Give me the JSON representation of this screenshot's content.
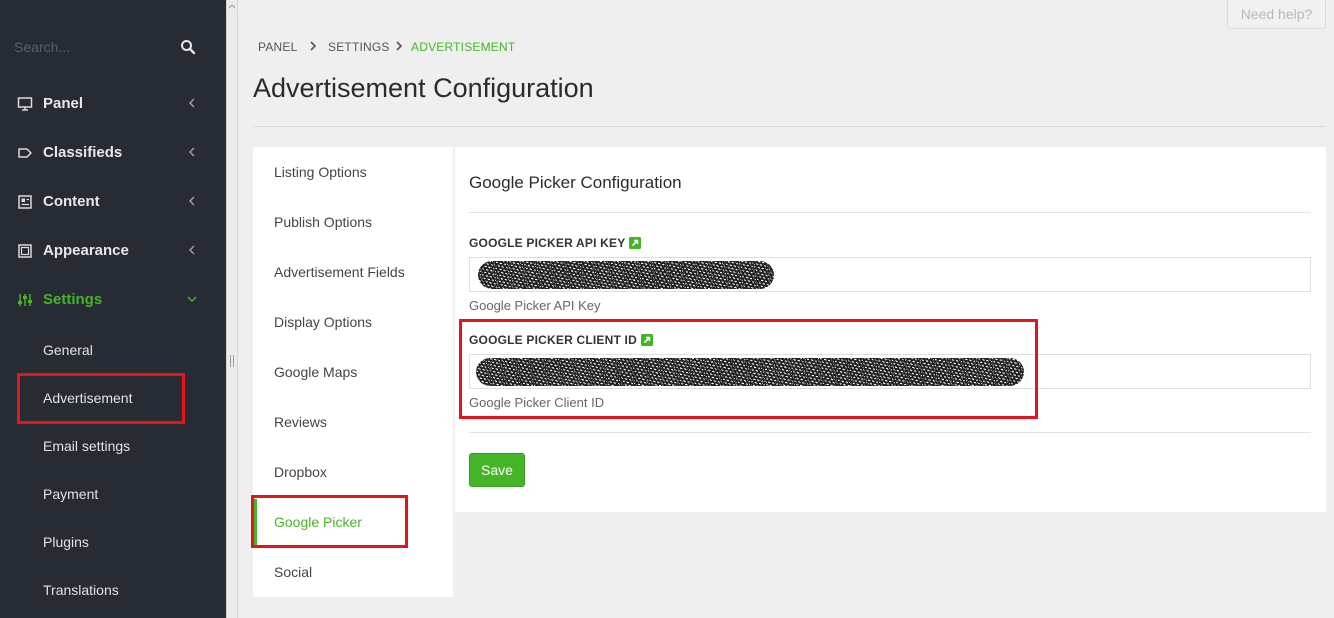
{
  "sidebar": {
    "search_placeholder": "Search...",
    "menu": [
      {
        "label": "Panel",
        "icon": "monitor-icon"
      },
      {
        "label": "Classifieds",
        "icon": "tag-icon"
      },
      {
        "label": "Content",
        "icon": "document-icon"
      },
      {
        "label": "Appearance",
        "icon": "window-icon"
      },
      {
        "label": "Settings",
        "icon": "sliders-icon",
        "expanded": true
      }
    ],
    "settings_submenu": [
      "General",
      "Advertisement",
      "Email settings",
      "Payment",
      "Plugins",
      "Translations"
    ],
    "highlighted_item": "Advertisement"
  },
  "header": {
    "help_button": "Need help?",
    "breadcrumb": [
      "PANEL",
      "SETTINGS",
      "ADVERTISEMENT"
    ],
    "title": "Advertisement Configuration"
  },
  "subnav": {
    "items": [
      "Listing Options",
      "Publish Options",
      "Advertisement Fields",
      "Display Options",
      "Google Maps",
      "Reviews",
      "Dropbox",
      "Google Picker",
      "Social"
    ],
    "active": "Google Picker"
  },
  "form": {
    "title": "Google Picker Configuration",
    "fields": [
      {
        "label": "GOOGLE PICKER API KEY",
        "help": "Google Picker API Key",
        "value_state": "redacted"
      },
      {
        "label": "GOOGLE PICKER CLIENT ID",
        "help": "Google Picker Client ID",
        "value_state": "redacted"
      }
    ],
    "save_label": "Save"
  },
  "colors": {
    "sidebar_bg": "#272b33",
    "accent": "#45b527",
    "highlight_box": "#e3141b",
    "page_bg": "#efefef"
  }
}
